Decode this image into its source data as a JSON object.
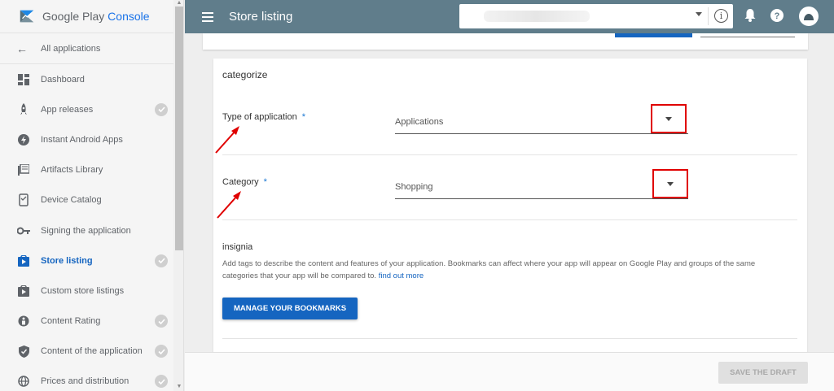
{
  "brand": {
    "name": "Google Play",
    "product": "Console"
  },
  "sidebar": {
    "back_label": "All applications",
    "items": [
      {
        "label": "Dashboard",
        "icon": "dashboard-icon",
        "checked": false,
        "active": false
      },
      {
        "label": "App releases",
        "icon": "rocket-icon",
        "checked": true,
        "active": false
      },
      {
        "label": "Instant Android Apps",
        "icon": "flash-icon",
        "checked": false,
        "active": false
      },
      {
        "label": "Artifacts Library",
        "icon": "library-icon",
        "checked": false,
        "active": false
      },
      {
        "label": "Device Catalog",
        "icon": "device-icon",
        "checked": false,
        "active": false
      },
      {
        "label": "Signing the application",
        "icon": "key-icon",
        "checked": false,
        "active": false
      },
      {
        "label": "Store listing",
        "icon": "store-icon",
        "checked": true,
        "active": true
      },
      {
        "label": "Custom store listings",
        "icon": "custom-store-icon",
        "checked": false,
        "active": false
      },
      {
        "label": "Content Rating",
        "icon": "rating-icon",
        "checked": true,
        "active": false
      },
      {
        "label": "Content of the application",
        "icon": "shield-icon",
        "checked": true,
        "active": false
      },
      {
        "label": "Prices and distribution",
        "icon": "globe-icon",
        "checked": true,
        "active": false
      }
    ]
  },
  "header": {
    "title": "Store listing",
    "info_glyph": "i"
  },
  "main": {
    "section_title": "categorize",
    "type_field": {
      "label": "Type of application",
      "required_mark": "*",
      "value": "Applications"
    },
    "category_field": {
      "label": "Category",
      "required_mark": "*",
      "value": "Shopping"
    },
    "badges": {
      "title": "insignia",
      "description": "Add tags to describe the content and features of your application. Bookmarks can affect where your app will appear on Google Play and groups of the same categories that your app will be compared to.",
      "link": "find out more",
      "button": "MANAGE YOUR BOOKMARKS"
    }
  },
  "footer": {
    "save_label": "SAVE THE DRAFT"
  },
  "colors": {
    "topbar": "#607d8b",
    "primary": "#1565c0",
    "highlight": "#e00000"
  }
}
